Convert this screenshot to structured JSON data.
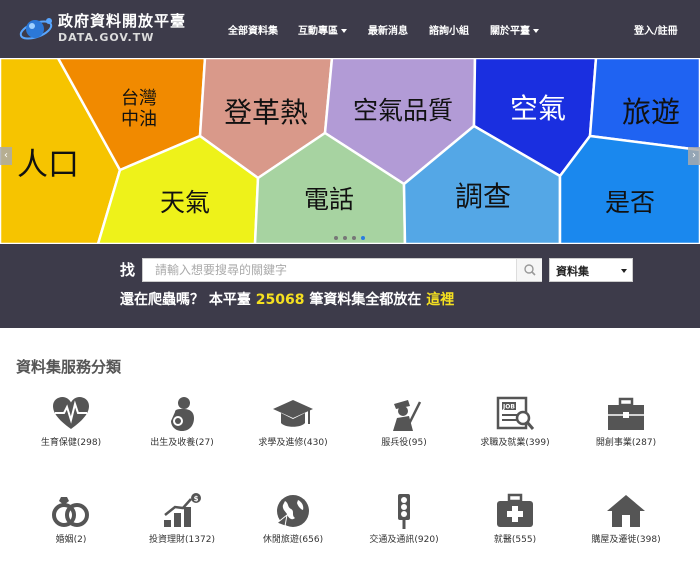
{
  "header": {
    "title": "政府資料開放平臺",
    "subtitle": "DATA.GOV.TW",
    "nav": [
      {
        "label": "全部資料集",
        "dropdown": false
      },
      {
        "label": "互動專區",
        "dropdown": true
      },
      {
        "label": "最新消息",
        "dropdown": false
      },
      {
        "label": "諮詢小組",
        "dropdown": false
      },
      {
        "label": "關於平臺",
        "dropdown": true
      }
    ],
    "login": "登入/註冊"
  },
  "banner": {
    "tiles": [
      {
        "label": "人口",
        "color": "#f6c400"
      },
      {
        "label": "台灣",
        "color": "#f18a00"
      },
      {
        "label": "中油",
        "color": "#f18a00"
      },
      {
        "label": "登革熱",
        "color": "#d9998a"
      },
      {
        "label": "空氣品質",
        "color": "#b29bd6"
      },
      {
        "label": "空氣",
        "color": "#1a2fe0"
      },
      {
        "label": "旅遊",
        "color": "#1f63f2"
      },
      {
        "label": "天氣",
        "color": "#eef21a"
      },
      {
        "label": "電話",
        "color": "#a7d3a1"
      },
      {
        "label": "調查",
        "color": "#54a7e6"
      },
      {
        "label": "是否",
        "color": "#1a88ee"
      }
    ],
    "slide_count": 4,
    "active_slide": 3
  },
  "search": {
    "label": "找",
    "placeholder": "請輸入想要搜尋的關鍵字",
    "type_selected": "資料集",
    "tagline_prefix": "還在爬蟲嗎？ 本平臺",
    "dataset_count": "25068",
    "tagline_mid": "筆資料集全都放在",
    "tagline_link": "這裡"
  },
  "categories": {
    "title": "資料集服務分類",
    "icon_color": "#555555",
    "items": [
      {
        "label": "生育保健(298)",
        "icon": "heart-pulse-icon"
      },
      {
        "label": "出生及收養(27)",
        "icon": "baby-icon"
      },
      {
        "label": "求學及進修(430)",
        "icon": "graduation-cap-icon"
      },
      {
        "label": "服兵役(95)",
        "icon": "soldier-icon"
      },
      {
        "label": "求職及就業(399)",
        "icon": "job-newspaper-icon"
      },
      {
        "label": "開創事業(287)",
        "icon": "briefcase-icon"
      },
      {
        "label": "婚姻(2)",
        "icon": "rings-icon"
      },
      {
        "label": "投資理財(1372)",
        "icon": "growth-chart-icon"
      },
      {
        "label": "休閒旅遊(656)",
        "icon": "globe-icon"
      },
      {
        "label": "交通及通訊(920)",
        "icon": "traffic-light-icon"
      },
      {
        "label": "就醫(555)",
        "icon": "medical-kit-icon"
      },
      {
        "label": "購屋及遷徙(398)",
        "icon": "house-icon"
      }
    ]
  }
}
